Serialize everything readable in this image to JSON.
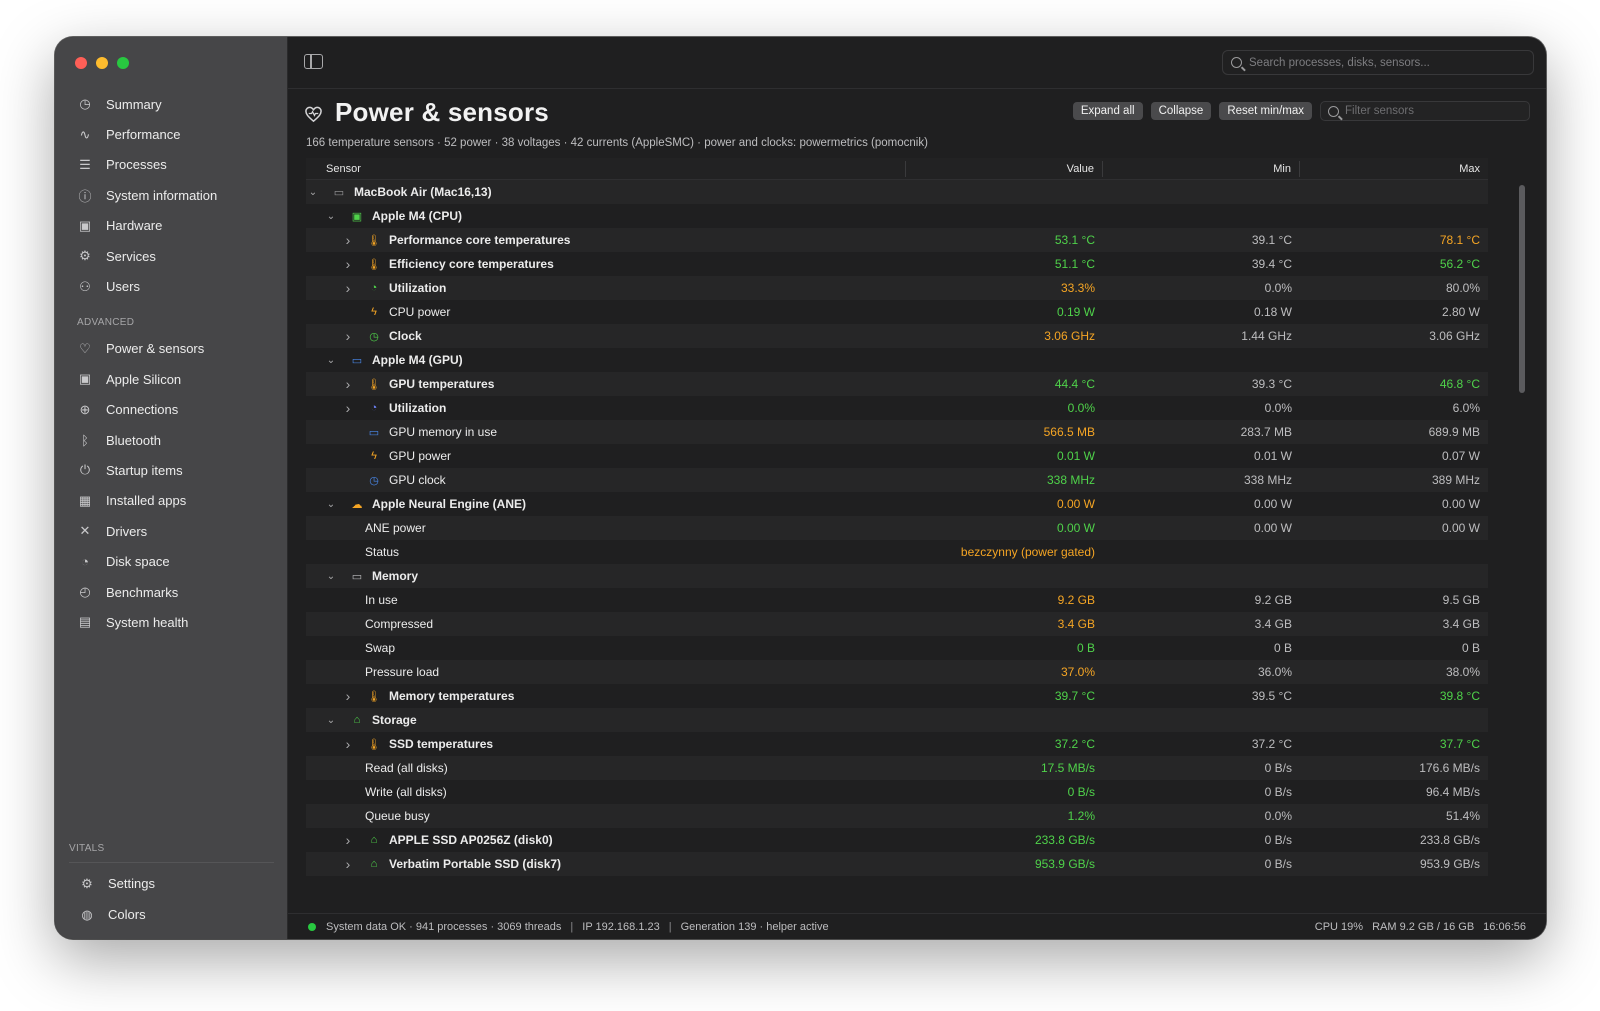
{
  "window": {
    "title": "Power & sensors"
  },
  "sidebar": {
    "items": [
      {
        "label": "Summary",
        "icon": "gauge-icon"
      },
      {
        "label": "Performance",
        "icon": "pulse-icon"
      },
      {
        "label": "Processes",
        "icon": "list-icon"
      },
      {
        "label": "System information",
        "icon": "info-icon"
      },
      {
        "label": "Hardware",
        "icon": "chip-icon"
      },
      {
        "label": "Services",
        "icon": "gears-icon"
      },
      {
        "label": "Users",
        "icon": "users-icon"
      }
    ],
    "advanced_label": "ADVANCED",
    "advanced_items": [
      {
        "label": "Power & sensors",
        "icon": "heart-pulse-icon"
      },
      {
        "label": "Apple Silicon",
        "icon": "cpu-icon"
      },
      {
        "label": "Connections",
        "icon": "globe-icon"
      },
      {
        "label": "Bluetooth",
        "icon": "bluetooth-icon"
      },
      {
        "label": "Startup items",
        "icon": "power-icon"
      },
      {
        "label": "Installed apps",
        "icon": "grid-icon"
      },
      {
        "label": "Drivers",
        "icon": "tools-icon"
      },
      {
        "label": "Disk space",
        "icon": "pie-icon"
      },
      {
        "label": "Benchmarks",
        "icon": "speedometer-icon"
      },
      {
        "label": "System health",
        "icon": "clipboard-icon"
      }
    ],
    "vitals_label": "VITALS",
    "bottom_items": [
      {
        "label": "Settings",
        "icon": "gear-icon"
      },
      {
        "label": "Colors",
        "icon": "palette-icon"
      }
    ]
  },
  "search": {
    "placeholder": "Search processes, disks, sensors..."
  },
  "header": {
    "title": "Power & sensors",
    "expand_all": "Expand all",
    "collapse": "Collapse",
    "reset": "Reset min/max",
    "filter_placeholder": "Filter sensors",
    "subtitle": "166 temperature sensors · 52 power · 38 voltages · 42 currents (AppleSMC) · power and clocks: powermetrics (pomocnik)"
  },
  "table": {
    "columns": {
      "sensor": "Sensor",
      "value": "Value",
      "min": "Min",
      "max": "Max"
    },
    "rows": [
      {
        "level": 0,
        "chevron": "v",
        "icon": "laptop-icon",
        "glyph": "▭",
        "icolor": "#9a9a9c",
        "label": "MacBook Air (Mac16,13)",
        "bold": true,
        "value": "",
        "vc": "",
        "min": "",
        "max": "",
        "mc": ""
      },
      {
        "level": 1,
        "chevron": "v",
        "icon": "cpu-chip-icon",
        "glyph": "▣",
        "icolor": "#4fd24a",
        "label": "Apple M4 (CPU)",
        "bold": true,
        "value": "",
        "vc": "",
        "min": "",
        "max": "",
        "mc": ""
      },
      {
        "level": 2,
        "chevron": ">",
        "icon": "thermometer-icon",
        "glyph": "🌡",
        "icolor": "#f5a524",
        "label": "Performance core temperatures",
        "bold": true,
        "value": "53.1 °C",
        "vc": "green",
        "min": "39.1 °C",
        "max": "78.1 °C",
        "mc": "orange"
      },
      {
        "level": 2,
        "chevron": ">",
        "icon": "thermometer-icon",
        "glyph": "🌡",
        "icolor": "#f5a524",
        "label": "Efficiency core temperatures",
        "bold": true,
        "value": "51.1 °C",
        "vc": "green",
        "min": "39.4 °C",
        "max": "56.2 °C",
        "mc": "green"
      },
      {
        "level": 2,
        "chevron": ">",
        "icon": "gauge-icon",
        "glyph": "◔",
        "icolor": "#4fd24a",
        "label": "Utilization",
        "bold": true,
        "value": "33.3%",
        "vc": "orange",
        "min": "0.0%",
        "max": "80.0%",
        "mc": "gray"
      },
      {
        "level": 2,
        "chevron": "",
        "icon": "bolt-icon",
        "glyph": "ϟ",
        "icolor": "#f5a524",
        "label": "CPU power",
        "bold": false,
        "value": "0.19 W",
        "vc": "green",
        "min": "0.18 W",
        "max": "2.80 W",
        "mc": "gray"
      },
      {
        "level": 2,
        "chevron": ">",
        "icon": "clock-icon",
        "glyph": "◷",
        "icolor": "#4fd24a",
        "label": "Clock",
        "bold": true,
        "value": "3.06 GHz",
        "vc": "orange",
        "min": "1.44 GHz",
        "max": "3.06 GHz",
        "mc": "gray"
      },
      {
        "level": 1,
        "chevron": "v",
        "icon": "monitor-icon",
        "glyph": "▭",
        "icolor": "#4a8bf0",
        "label": "Apple M4 (GPU)",
        "bold": true,
        "value": "",
        "vc": "",
        "min": "",
        "max": "",
        "mc": ""
      },
      {
        "level": 2,
        "chevron": ">",
        "icon": "thermometer-icon",
        "glyph": "🌡",
        "icolor": "#f5a524",
        "label": "GPU temperatures",
        "bold": true,
        "value": "44.4 °C",
        "vc": "green",
        "min": "39.3 °C",
        "max": "46.8 °C",
        "mc": "green"
      },
      {
        "level": 2,
        "chevron": ">",
        "icon": "gauge-icon",
        "glyph": "◔",
        "icolor": "#6a7ff0",
        "label": "Utilization",
        "bold": true,
        "value": "0.0%",
        "vc": "green",
        "min": "0.0%",
        "max": "6.0%",
        "mc": "gray"
      },
      {
        "level": 2,
        "chevron": "",
        "icon": "memory-icon",
        "glyph": "▭",
        "icolor": "#4a8bf0",
        "label": "GPU memory in use",
        "bold": false,
        "value": "566.5 MB",
        "vc": "orange",
        "min": "283.7 MB",
        "max": "689.9 MB",
        "mc": "gray"
      },
      {
        "level": 2,
        "chevron": "",
        "icon": "bolt-icon",
        "glyph": "ϟ",
        "icolor": "#f5a524",
        "label": "GPU power",
        "bold": false,
        "value": "0.01 W",
        "vc": "green",
        "min": "0.01 W",
        "max": "0.07 W",
        "mc": "gray"
      },
      {
        "level": 2,
        "chevron": "",
        "icon": "clock-icon",
        "glyph": "◷",
        "icolor": "#4a8bf0",
        "label": "GPU clock",
        "bold": false,
        "value": "338 MHz",
        "vc": "green",
        "min": "338 MHz",
        "max": "389 MHz",
        "mc": "gray"
      },
      {
        "level": 1,
        "chevron": "v",
        "icon": "brain-icon",
        "glyph": "☁",
        "icolor": "#f5a524",
        "label": "Apple Neural Engine (ANE)",
        "bold": true,
        "value": "0.00 W",
        "vc": "orange",
        "min": "0.00 W",
        "max": "0.00 W",
        "mc": "gray"
      },
      {
        "level": 1.5,
        "chevron": "",
        "icon": "",
        "glyph": "",
        "icolor": "",
        "label": "ANE power",
        "bold": false,
        "value": "0.00 W",
        "vc": "green",
        "min": "0.00 W",
        "max": "0.00 W",
        "mc": "gray"
      },
      {
        "level": 1.5,
        "chevron": "",
        "icon": "",
        "glyph": "",
        "icolor": "",
        "label": "Status",
        "bold": false,
        "value": "bezczynny (power gated)",
        "vc": "orange",
        "min": "",
        "max": "",
        "mc": ""
      },
      {
        "level": 1,
        "chevron": "v",
        "icon": "memory-icon",
        "glyph": "▭",
        "icolor": "#bdbdbf",
        "label": "Memory",
        "bold": true,
        "value": "",
        "vc": "",
        "min": "",
        "max": "",
        "mc": ""
      },
      {
        "level": 1.5,
        "chevron": "",
        "icon": "",
        "glyph": "",
        "icolor": "",
        "label": "In use",
        "bold": false,
        "value": "9.2 GB",
        "vc": "orange",
        "min": "9.2 GB",
        "max": "9.5 GB",
        "mc": "gray"
      },
      {
        "level": 1.5,
        "chevron": "",
        "icon": "",
        "glyph": "",
        "icolor": "",
        "label": "Compressed",
        "bold": false,
        "value": "3.4 GB",
        "vc": "orange",
        "min": "3.4 GB",
        "max": "3.4 GB",
        "mc": "gray"
      },
      {
        "level": 1.5,
        "chevron": "",
        "icon": "",
        "glyph": "",
        "icolor": "",
        "label": "Swap",
        "bold": false,
        "value": "0 B",
        "vc": "green",
        "min": "0 B",
        "max": "0 B",
        "mc": "gray"
      },
      {
        "level": 1.5,
        "chevron": "",
        "icon": "",
        "glyph": "",
        "icolor": "",
        "label": "Pressure load",
        "bold": false,
        "value": "37.0%",
        "vc": "orange",
        "min": "36.0%",
        "max": "38.0%",
        "mc": "gray"
      },
      {
        "level": 2,
        "chevron": ">",
        "icon": "thermometer-icon",
        "glyph": "🌡",
        "icolor": "#f5a524",
        "label": "Memory temperatures",
        "bold": true,
        "value": "39.7 °C",
        "vc": "green",
        "min": "39.5 °C",
        "max": "39.8 °C",
        "mc": "green"
      },
      {
        "level": 1,
        "chevron": "v",
        "icon": "drive-icon",
        "glyph": "⌂",
        "icolor": "#4fd24a",
        "label": "Storage",
        "bold": true,
        "value": "",
        "vc": "",
        "min": "",
        "max": "",
        "mc": ""
      },
      {
        "level": 2,
        "chevron": ">",
        "icon": "thermometer-icon",
        "glyph": "🌡",
        "icolor": "#f5a524",
        "label": "SSD temperatures",
        "bold": true,
        "value": "37.2 °C",
        "vc": "green",
        "min": "37.2 °C",
        "max": "37.7 °C",
        "mc": "green"
      },
      {
        "level": 1.5,
        "chevron": "",
        "icon": "",
        "glyph": "",
        "icolor": "",
        "label": "Read (all disks)",
        "bold": false,
        "value": "17.5 MB/s",
        "vc": "green",
        "min": "0 B/s",
        "max": "176.6 MB/s",
        "mc": "gray"
      },
      {
        "level": 1.5,
        "chevron": "",
        "icon": "",
        "glyph": "",
        "icolor": "",
        "label": "Write (all disks)",
        "bold": false,
        "value": "0 B/s",
        "vc": "green",
        "min": "0 B/s",
        "max": "96.4 MB/s",
        "mc": "gray"
      },
      {
        "level": 1.5,
        "chevron": "",
        "icon": "",
        "glyph": "",
        "icolor": "",
        "label": "Queue busy",
        "bold": false,
        "value": "1.2%",
        "vc": "green",
        "min": "0.0%",
        "max": "51.4%",
        "mc": "gray"
      },
      {
        "level": 2,
        "chevron": ">",
        "icon": "drive-icon",
        "glyph": "⌂",
        "icolor": "#4fd24a",
        "label": "APPLE SSD AP0256Z (disk0)",
        "bold": true,
        "value": "233.8 GB/s",
        "vc": "green",
        "min": "0 B/s",
        "max": "233.8 GB/s",
        "mc": "gray"
      },
      {
        "level": 2,
        "chevron": ">",
        "icon": "drive-icon",
        "glyph": "⌂",
        "icolor": "#4fd24a",
        "label": "Verbatim Portable SSD (disk7)",
        "bold": true,
        "value": "953.9 GB/s",
        "vc": "green",
        "min": "0 B/s",
        "max": "953.9 GB/s",
        "mc": "gray"
      }
    ]
  },
  "status": {
    "text": "System data OK · 941 processes · 3069 threads",
    "ip": "IP 192.168.1.23",
    "generation": "Generation 139 · helper active",
    "cpu": "CPU 19%",
    "ram": "RAM 9.2 GB / 16 GB",
    "time": "16:06:56"
  },
  "colors": {
    "good": "#4fd24a",
    "warn": "#f5a524",
    "sidebar_bg": "#464648",
    "content_bg": "#1f1f20"
  }
}
